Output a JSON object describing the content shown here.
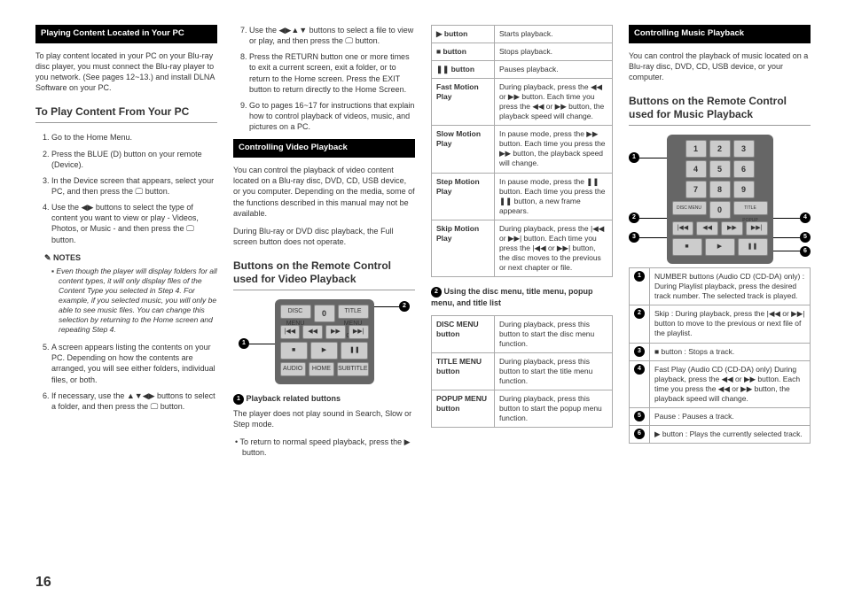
{
  "col1": {
    "header": "Playing Content Located in Your PC",
    "intro": "To play content located in your PC on your Blu-ray disc player, you must connect the Blu-ray player to you network. (See pages 12~13.) and install DLNA Software on your PC.",
    "h2": "To Play Content From Your PC",
    "steps": [
      "Go to the Home Menu.",
      "Press the BLUE (D) button on your remote (Device).",
      "In the Device screen that appears, select your PC, and then press the 🖵 button.",
      "Use the ◀▶ buttons to select the type of content you want to view or play - Videos, Photos, or Music - and then press the 🖵 button."
    ],
    "notesLabel": "NOTES",
    "note1": "Even though the player will display folders for all content types, it will only display files of the Content Type you selected in Step 4. For example, if you selected music, you will only be able to see music files. You can change this selection by returning to the Home screen and repeating Step 4.",
    "step5": "A screen appears listing the contents on your PC. Depending on how the contents are arranged, you will see either folders, individual files, or both.",
    "step6": "If necessary, use the ▲▼◀▶ buttons to select a folder, and then press the 🖵 button."
  },
  "col2": {
    "step7": "Use the ◀▶▲▼ buttons to select a file to view or play, and then press the 🖵 button.",
    "step8": "Press the RETURN button one or more times to exit a current screen, exit a folder, or to return to the Home screen. Press the EXIT button to return directly to the Home Screen.",
    "step9": "Go to pages 16~17 for instructions that explain how to control playback of videos, music, and pictures on a PC.",
    "header2": "Controlling Video Playback",
    "intro2": "You can control the playback of video content located on a Blu-ray disc, DVD, CD, USB device, or you computer. Depending on the media, some of the functions described in this manual may not be available.",
    "note2": "During Blu-ray or DVD disc playback, the Full screen button does not operate.",
    "h2b": "Buttons on the Remote Control used for Video Playback",
    "sub1Title": "Playback related buttons",
    "sub1Desc": "The player does not play sound in Search, Slow or Step mode.",
    "sub1Bullet": "To return to normal speed playback, press the ▶ button."
  },
  "col3": {
    "rows": [
      [
        "▶ button",
        "Starts playback."
      ],
      [
        "■ button",
        "Stops playback."
      ],
      [
        "❚❚ button",
        "Pauses playback."
      ],
      [
        "Fast Motion Play",
        "During playback, press the ◀◀ or ▶▶ button.\nEach time you press the ◀◀ or ▶▶ button, the playback speed will change."
      ],
      [
        "Slow Motion Play",
        "In pause mode, press the ▶▶ button.\nEach time you press the ▶▶ button, the playback speed will change."
      ],
      [
        "Step Motion Play",
        "In pause mode, press the ❚❚ button.\nEach time you press the ❚❚ button, a new frame appears."
      ],
      [
        "Skip Motion Play",
        "During playback, press the |◀◀ or ▶▶| button.\nEach time you press the |◀◀ or ▶▶| button, the disc moves to the previous or next chapter or file."
      ]
    ],
    "sec2Title": "Using the disc menu, title menu, popup menu, and title list",
    "rows2": [
      [
        "DISC MENU button",
        "During playback, press this button to start the disc menu function."
      ],
      [
        "TITLE MENU button",
        "During playback, press this button to start the title menu function."
      ],
      [
        "POPUP MENU button",
        "During playback, press this button to start the popup menu function."
      ]
    ]
  },
  "col4": {
    "header": "Controlling Music Playback",
    "intro": "You can control the playback of music located on a Blu-ray disc, DVD, CD, USB device, or your computer.",
    "h2": "Buttons on the Remote Control used for Music Playback",
    "rows": [
      "NUMBER buttons (Audio CD (CD-DA) only) : During Playlist playback, press the desired track number.\nThe selected track is played.",
      "Skip : During playback, press the |◀◀ or ▶▶| button to move to the previous or next file of the playlist.",
      "■ button : Stops a track.",
      "Fast Play (Audio CD (CD-DA) only)\nDuring playback, press the ◀◀ or ▶▶ button.\nEach time you press the ◀◀ or ▶▶ button, the playback speed will change.",
      "Pause : Pauses a track.",
      "▶ button : Plays the currently selected track."
    ]
  },
  "pageNumber": "16"
}
